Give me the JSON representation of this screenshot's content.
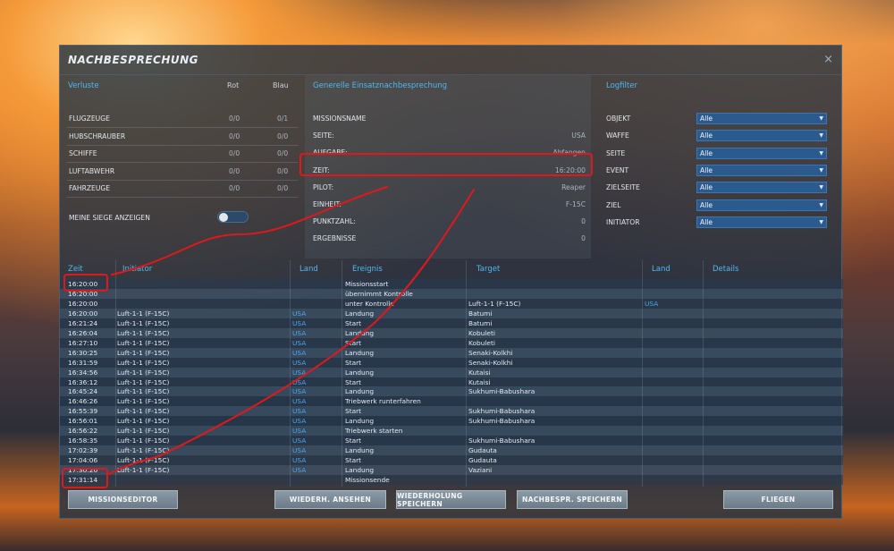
{
  "dialog": {
    "title": "NACHBESPRECHUNG",
    "close_label": "×"
  },
  "losses": {
    "heading": "Verluste",
    "col_red": "Rot",
    "col_blue": "Blau",
    "rows": [
      {
        "label": "FLUGZEUGE",
        "red": "0/0",
        "blue": "0/1"
      },
      {
        "label": "HUBSCHRAUBER",
        "red": "0/0",
        "blue": "0/0"
      },
      {
        "label": "SCHIFFE",
        "red": "0/0",
        "blue": "0/0"
      },
      {
        "label": "LUFTABWEHR",
        "red": "0/0",
        "blue": "0/0"
      },
      {
        "label": "FAHRZEUGE",
        "red": "0/0",
        "blue": "0/0"
      }
    ],
    "toggle_label": "MEINE SIEGE ANZEIGEN"
  },
  "general": {
    "heading": "Generelle Einsatznachbesprechung",
    "rows": [
      {
        "label": "MISSIONSNAME",
        "value": ""
      },
      {
        "label": "SEITE:",
        "value": "USA"
      },
      {
        "label": "AUFGABE:",
        "value": "Abfangen"
      },
      {
        "label": "ZEIT:",
        "value": "16:20:00"
      },
      {
        "label": "PILOT:",
        "value": "Reaper"
      },
      {
        "label": "EINHEIT:",
        "value": "F-15C"
      },
      {
        "label": "PUNKTZAHL:",
        "value": "0"
      },
      {
        "label": "ERGEBNISSE",
        "value": "0"
      }
    ]
  },
  "logfilter": {
    "heading": "Logfilter",
    "rows": [
      {
        "label": "OBJEKT",
        "value": "Alle"
      },
      {
        "label": "WAFFE",
        "value": "Alle"
      },
      {
        "label": "SEITE",
        "value": "Alle"
      },
      {
        "label": "EVENT",
        "value": "Alle"
      },
      {
        "label": "ZIELSEITE",
        "value": "Alle"
      },
      {
        "label": "ZIEL",
        "value": "Alle"
      },
      {
        "label": "INITIATOR",
        "value": "Alle"
      }
    ]
  },
  "log": {
    "columns": [
      "Zeit",
      "Initiator",
      "Land",
      "Ereignis",
      "Target",
      "Land",
      "Details"
    ],
    "rows": [
      [
        "16:20:00",
        "",
        "",
        "Missionsstart",
        "",
        "",
        ""
      ],
      [
        "16:20:00",
        "",
        "",
        "übernimmt Kontrolle",
        "",
        "",
        ""
      ],
      [
        "16:20:00",
        "",
        "",
        "unter Kontrolle",
        "Luft-1-1 (F-15C)",
        "USA",
        ""
      ],
      [
        "16:20:00",
        "Luft-1-1 (F-15C)",
        "USA",
        "Landung",
        "Batumi",
        "",
        ""
      ],
      [
        "16:21:24",
        "Luft-1-1 (F-15C)",
        "USA",
        "Start",
        "Batumi",
        "",
        ""
      ],
      [
        "16:26:04",
        "Luft-1-1 (F-15C)",
        "USA",
        "Landung",
        "Kobuleti",
        "",
        ""
      ],
      [
        "16:27:10",
        "Luft-1-1 (F-15C)",
        "USA",
        "Start",
        "Kobuleti",
        "",
        ""
      ],
      [
        "16:30:25",
        "Luft-1-1 (F-15C)",
        "USA",
        "Landung",
        "Senaki-Kolkhi",
        "",
        ""
      ],
      [
        "16:31:59",
        "Luft-1-1 (F-15C)",
        "USA",
        "Start",
        "Senaki-Kolkhi",
        "",
        ""
      ],
      [
        "16:34:56",
        "Luft-1-1 (F-15C)",
        "USA",
        "Landung",
        "Kutaisi",
        "",
        ""
      ],
      [
        "16:36:12",
        "Luft-1-1 (F-15C)",
        "USA",
        "Start",
        "Kutaisi",
        "",
        ""
      ],
      [
        "16:45:24",
        "Luft-1-1 (F-15C)",
        "USA",
        "Landung",
        "Sukhumi-Babushara",
        "",
        ""
      ],
      [
        "16:46:26",
        "Luft-1-1 (F-15C)",
        "USA",
        "Triebwerk runterfahren",
        "",
        "",
        ""
      ],
      [
        "16:55:39",
        "Luft-1-1 (F-15C)",
        "USA",
        "Start",
        "Sukhumi-Babushara",
        "",
        ""
      ],
      [
        "16:56:01",
        "Luft-1-1 (F-15C)",
        "USA",
        "Landung",
        "Sukhumi-Babushara",
        "",
        ""
      ],
      [
        "16:56:22",
        "Luft-1-1 (F-15C)",
        "USA",
        "Triebwerk starten",
        "",
        "",
        ""
      ],
      [
        "16:58:35",
        "Luft-1-1 (F-15C)",
        "USA",
        "Start",
        "Sukhumi-Babushara",
        "",
        ""
      ],
      [
        "17:02:39",
        "Luft-1-1 (F-15C)",
        "USA",
        "Landung",
        "Gudauta",
        "",
        ""
      ],
      [
        "17:04:06",
        "Luft-1-1 (F-15C)",
        "USA",
        "Start",
        "Gudauta",
        "",
        ""
      ],
      [
        "17:30:20",
        "Luft-1-1 (F-15C)",
        "USA",
        "Landung",
        "Vaziani",
        "",
        ""
      ],
      [
        "17:31:14",
        "",
        "",
        "Missionsende",
        "",
        "",
        ""
      ]
    ]
  },
  "buttons": {
    "mission_editor": "MISSIONSEDITOR",
    "replay_view": "WIEDERH. ANSEHEN",
    "replay_save": "WIEDERHOLUNG SPEICHERN",
    "debrief_save": "NACHBESPR. SPEICHERN",
    "fly": "FLIEGEN"
  },
  "colors": {
    "accent": "#4fb8f0",
    "annotation": "#e0181c",
    "select_bg": "#2a5a8e"
  }
}
